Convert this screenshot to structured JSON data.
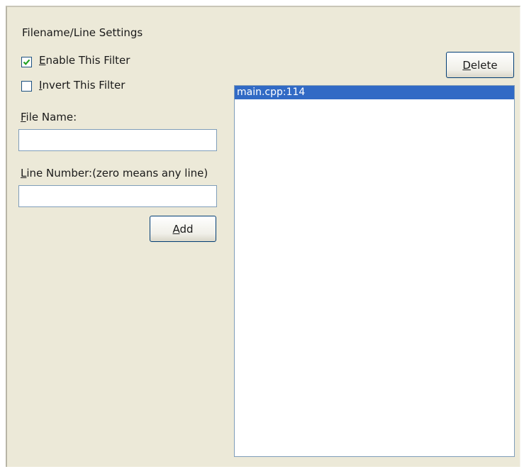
{
  "group": {
    "title": "Filename/Line Settings"
  },
  "enable_filter": {
    "label_accel": "E",
    "label_rest": "nable This Filter",
    "checked": true
  },
  "invert_filter": {
    "label_accel": "I",
    "label_rest": "nvert This Filter",
    "checked": false
  },
  "file_name": {
    "label_accel": "F",
    "label_rest": "ile Name:",
    "value": ""
  },
  "line_number": {
    "label_accel": "L",
    "label_rest": "ine Number:(zero means any line)",
    "value": ""
  },
  "add_button": {
    "label_accel": "A",
    "label_rest": "dd"
  },
  "delete_button": {
    "label_accel": "D",
    "label_rest": "elete"
  },
  "filter_list": {
    "items": [
      {
        "label": "main.cpp:114",
        "selected": true
      }
    ]
  },
  "colors": {
    "panel_bg": "#ece9d8",
    "selection_bg": "#316ac5",
    "selection_text": "#ffffff",
    "input_border": "#7f9db9",
    "button_border": "#003c74",
    "checkmark": "#21a121"
  }
}
